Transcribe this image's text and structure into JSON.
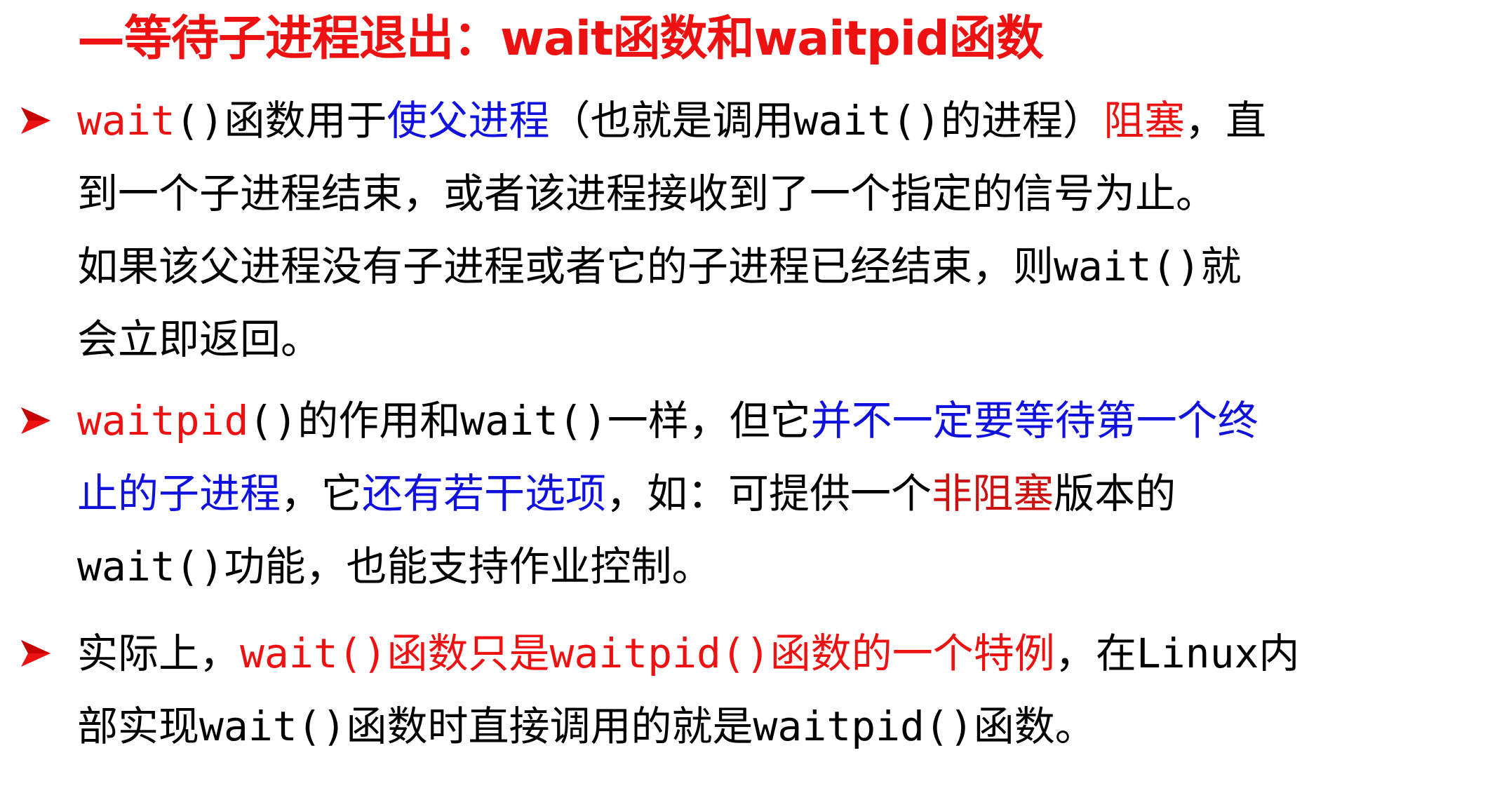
{
  "colors": {
    "title": "#ee1111",
    "red": "#ee1111",
    "blue": "#1111dd",
    "dark_red": "#cc1111",
    "text": "#000000",
    "marker": "#ee1111"
  },
  "title": "—等待子进程退出：wait函数和waitpid函数",
  "bullets": [
    {
      "marker_icon": "arrow-bullet-icon",
      "lines": [
        [
          {
            "text": "wait",
            "color": "red"
          },
          {
            "text": "()函数用于",
            "color": "text"
          },
          {
            "text": "使父进程",
            "color": "blue"
          },
          {
            "text": "（也就是调用wait()的进程）",
            "color": "text"
          },
          {
            "text": "阻塞",
            "color": "red"
          },
          {
            "text": "，直",
            "color": "text"
          }
        ],
        [
          {
            "text": "到一个子进程结束，或者该进程接收到了一个指定的信号为止。",
            "color": "text"
          }
        ],
        [
          {
            "text": "如果该父进程没有子进程或者它的子进程已经结束，则wait()就",
            "color": "text"
          }
        ],
        [
          {
            "text": "会立即返回。",
            "color": "text"
          }
        ]
      ]
    },
    {
      "marker_icon": "arrow-bullet-icon",
      "lines": [
        [
          {
            "text": "waitpid",
            "color": "red"
          },
          {
            "text": "()的作用和wait()一样，但它",
            "color": "text"
          },
          {
            "text": "并不一定要等待第一个终",
            "color": "blue"
          }
        ],
        [
          {
            "text": "止的子进程",
            "color": "blue"
          },
          {
            "text": "，它",
            "color": "text"
          },
          {
            "text": "还有若干选项",
            "color": "blue"
          },
          {
            "text": "，如：可提供一个",
            "color": "text"
          },
          {
            "text": "非阻塞",
            "color": "dark_red"
          },
          {
            "text": "版本的",
            "color": "text"
          }
        ],
        [
          {
            "text": "wait()功能，也能支持作业控制。",
            "color": "text"
          }
        ]
      ]
    },
    {
      "marker_icon": "arrow-bullet-icon",
      "lines": [
        [
          {
            "text": "实际上，",
            "color": "text"
          },
          {
            "text": "wait()函数只是waitpid()函数的一个特例",
            "color": "red"
          },
          {
            "text": "，在Linux内",
            "color": "text"
          }
        ],
        [
          {
            "text": "部实现wait()函数时直接调用的就是waitpid()函数。",
            "color": "text"
          }
        ]
      ]
    }
  ]
}
